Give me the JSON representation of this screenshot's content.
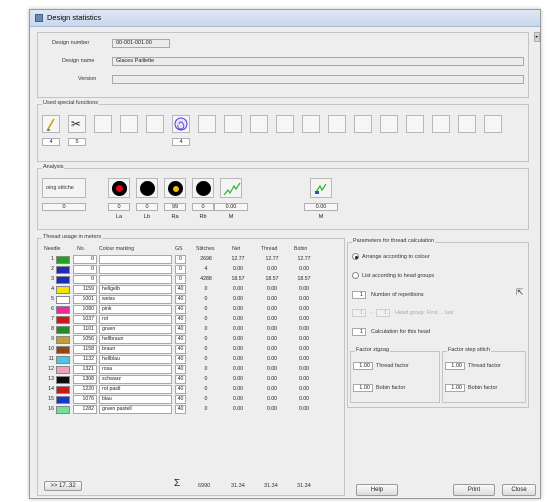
{
  "window": {
    "title": "Design statistics"
  },
  "design": {
    "number_label": "Design number",
    "number_value": "00-001-001.00",
    "name_label": "Design name",
    "name_value": "Glaces Paillette",
    "version_label": "Version",
    "version_value": ""
  },
  "special_functions": {
    "legend": "Used special functions",
    "items": [
      {
        "icon": "needle-icon",
        "count": "4"
      },
      {
        "icon": "scissors-icon",
        "count": "5"
      },
      {
        "icon": "",
        "count": ""
      },
      {
        "icon": "",
        "count": ""
      },
      {
        "icon": "",
        "count": ""
      },
      {
        "icon": "spiral-icon",
        "count": "4"
      }
    ]
  },
  "analysis": {
    "legend": "Analysis",
    "first_box_label": "oing stitche",
    "first_value": "0",
    "colors": {
      "red": "#e3001b",
      "yellow": "#f0c000",
      "black": "#000000",
      "green": "#2ab52a"
    },
    "values": [
      {
        "value": "0",
        "caption": "La"
      },
      {
        "value": "0",
        "caption": "Lb"
      },
      {
        "value": "99",
        "caption": "Ra"
      },
      {
        "value": "0",
        "caption": "Rb"
      },
      {
        "value": "0.00",
        "caption": "M"
      },
      {
        "value": "0.00",
        "caption": "M"
      }
    ]
  },
  "thread_usage": {
    "legend": "Thread usage in meters",
    "headers": [
      "Needle",
      "No.",
      "Colour marking",
      "GS",
      "Stitches",
      "Net",
      "Thread",
      "Bobin"
    ],
    "rows": [
      {
        "needle": "1",
        "color": "#22a022",
        "no": "0",
        "marking": "",
        "gs": "0",
        "stitches": "2698",
        "net": "12.77",
        "thread": "12.77",
        "bobin": "12.77"
      },
      {
        "needle": "2",
        "color": "#1b2fb5",
        "no": "0",
        "marking": "",
        "gs": "0",
        "stitches": "4",
        "net": "0.00",
        "thread": "0.00",
        "bobin": "0.00"
      },
      {
        "needle": "3",
        "color": "#1b2fb5",
        "no": "0",
        "marking": "",
        "gs": "0",
        "stitches": "4288",
        "net": "18.57",
        "thread": "18.57",
        "bobin": "18.57"
      },
      {
        "needle": "4",
        "color": "#f2e600",
        "no": "1159",
        "marking": "hellgelb",
        "gs": "40",
        "stitches": "0",
        "net": "0.00",
        "thread": "0.00",
        "bobin": "0.00"
      },
      {
        "needle": "5",
        "color": "#ffffff",
        "no": "1001",
        "marking": "weiss",
        "gs": "40",
        "stitches": "0",
        "net": "0.00",
        "thread": "0.00",
        "bobin": "0.00"
      },
      {
        "needle": "6",
        "color": "#e82a9a",
        "no": "1080",
        "marking": "pink",
        "gs": "40",
        "stitches": "0",
        "net": "0.00",
        "thread": "0.00",
        "bobin": "0.00"
      },
      {
        "needle": "7",
        "color": "#d01818",
        "no": "1037",
        "marking": "rot",
        "gs": "40",
        "stitches": "0",
        "net": "0.00",
        "thread": "0.00",
        "bobin": "0.00"
      },
      {
        "needle": "8",
        "color": "#1e8a2a",
        "no": "1101",
        "marking": "gruen",
        "gs": "40",
        "stitches": "0",
        "net": "0.00",
        "thread": "0.00",
        "bobin": "0.00"
      },
      {
        "needle": "9",
        "color": "#c89a3a",
        "no": "1056",
        "marking": "hellbraun",
        "gs": "40",
        "stitches": "0",
        "net": "0.00",
        "thread": "0.00",
        "bobin": "0.00"
      },
      {
        "needle": "10",
        "color": "#8a4a12",
        "no": "1158",
        "marking": "braun",
        "gs": "40",
        "stitches": "0",
        "net": "0.00",
        "thread": "0.00",
        "bobin": "0.00"
      },
      {
        "needle": "11",
        "color": "#4ec4ea",
        "no": "1132",
        "marking": "hellblau",
        "gs": "40",
        "stitches": "0",
        "net": "0.00",
        "thread": "0.00",
        "bobin": "0.00"
      },
      {
        "needle": "12",
        "color": "#e8a4c0",
        "no": "1321",
        "marking": "rosa",
        "gs": "40",
        "stitches": "0",
        "net": "0.00",
        "thread": "0.00",
        "bobin": "0.00"
      },
      {
        "needle": "13",
        "color": "#0c0c0c",
        "no": "1308",
        "marking": "schwarz",
        "gs": "40",
        "stitches": "0",
        "net": "0.00",
        "thread": "0.00",
        "bobin": "0.00"
      },
      {
        "needle": "14",
        "color": "#c81818",
        "no": "1220",
        "marking": "rot pastl",
        "gs": "40",
        "stitches": "0",
        "net": "0.00",
        "thread": "0.00",
        "bobin": "0.00"
      },
      {
        "needle": "15",
        "color": "#1838c8",
        "no": "1076",
        "marking": "blau",
        "gs": "40",
        "stitches": "0",
        "net": "0.00",
        "thread": "0.00",
        "bobin": "0.00"
      },
      {
        "needle": "16",
        "color": "#6ee0a0",
        "no": "1282",
        "marking": "gruen pastell",
        "gs": "40",
        "stitches": "0",
        "net": "0.00",
        "thread": "0.00",
        "bobin": "0.00"
      }
    ],
    "next_button": ">> 17..32",
    "totals": {
      "stitches": "6990",
      "net": "31.34",
      "thread": "31.34",
      "bobin": "31.34"
    }
  },
  "params": {
    "legend": "Parameters for thread calculation",
    "opt_colour": "Arrange according to colour",
    "opt_head_groups": "List according to head groups",
    "repetitions_value": "1",
    "repetitions_label": "Number of repetitions",
    "range_from": "1",
    "range_to": "1",
    "range_label": "Head group: First ... last",
    "calc_head_value": "1",
    "calc_head_label": "Calculation for this head",
    "zigzag_legend": "Factor zigzag",
    "zz_thread_value": "1.00",
    "zz_thread_label": "Thread factor",
    "zz_bobin_value": "1.00",
    "zz_bobin_label": "Bobin factor",
    "step_legend": "Factor step stitch",
    "st_thread_value": "1.00",
    "st_thread_label": "Thread factor",
    "st_bobin_value": "1.00",
    "st_bobin_label": "Bobin factor"
  },
  "buttons": {
    "help": "Help",
    "print": "Print",
    "close": "Close"
  }
}
